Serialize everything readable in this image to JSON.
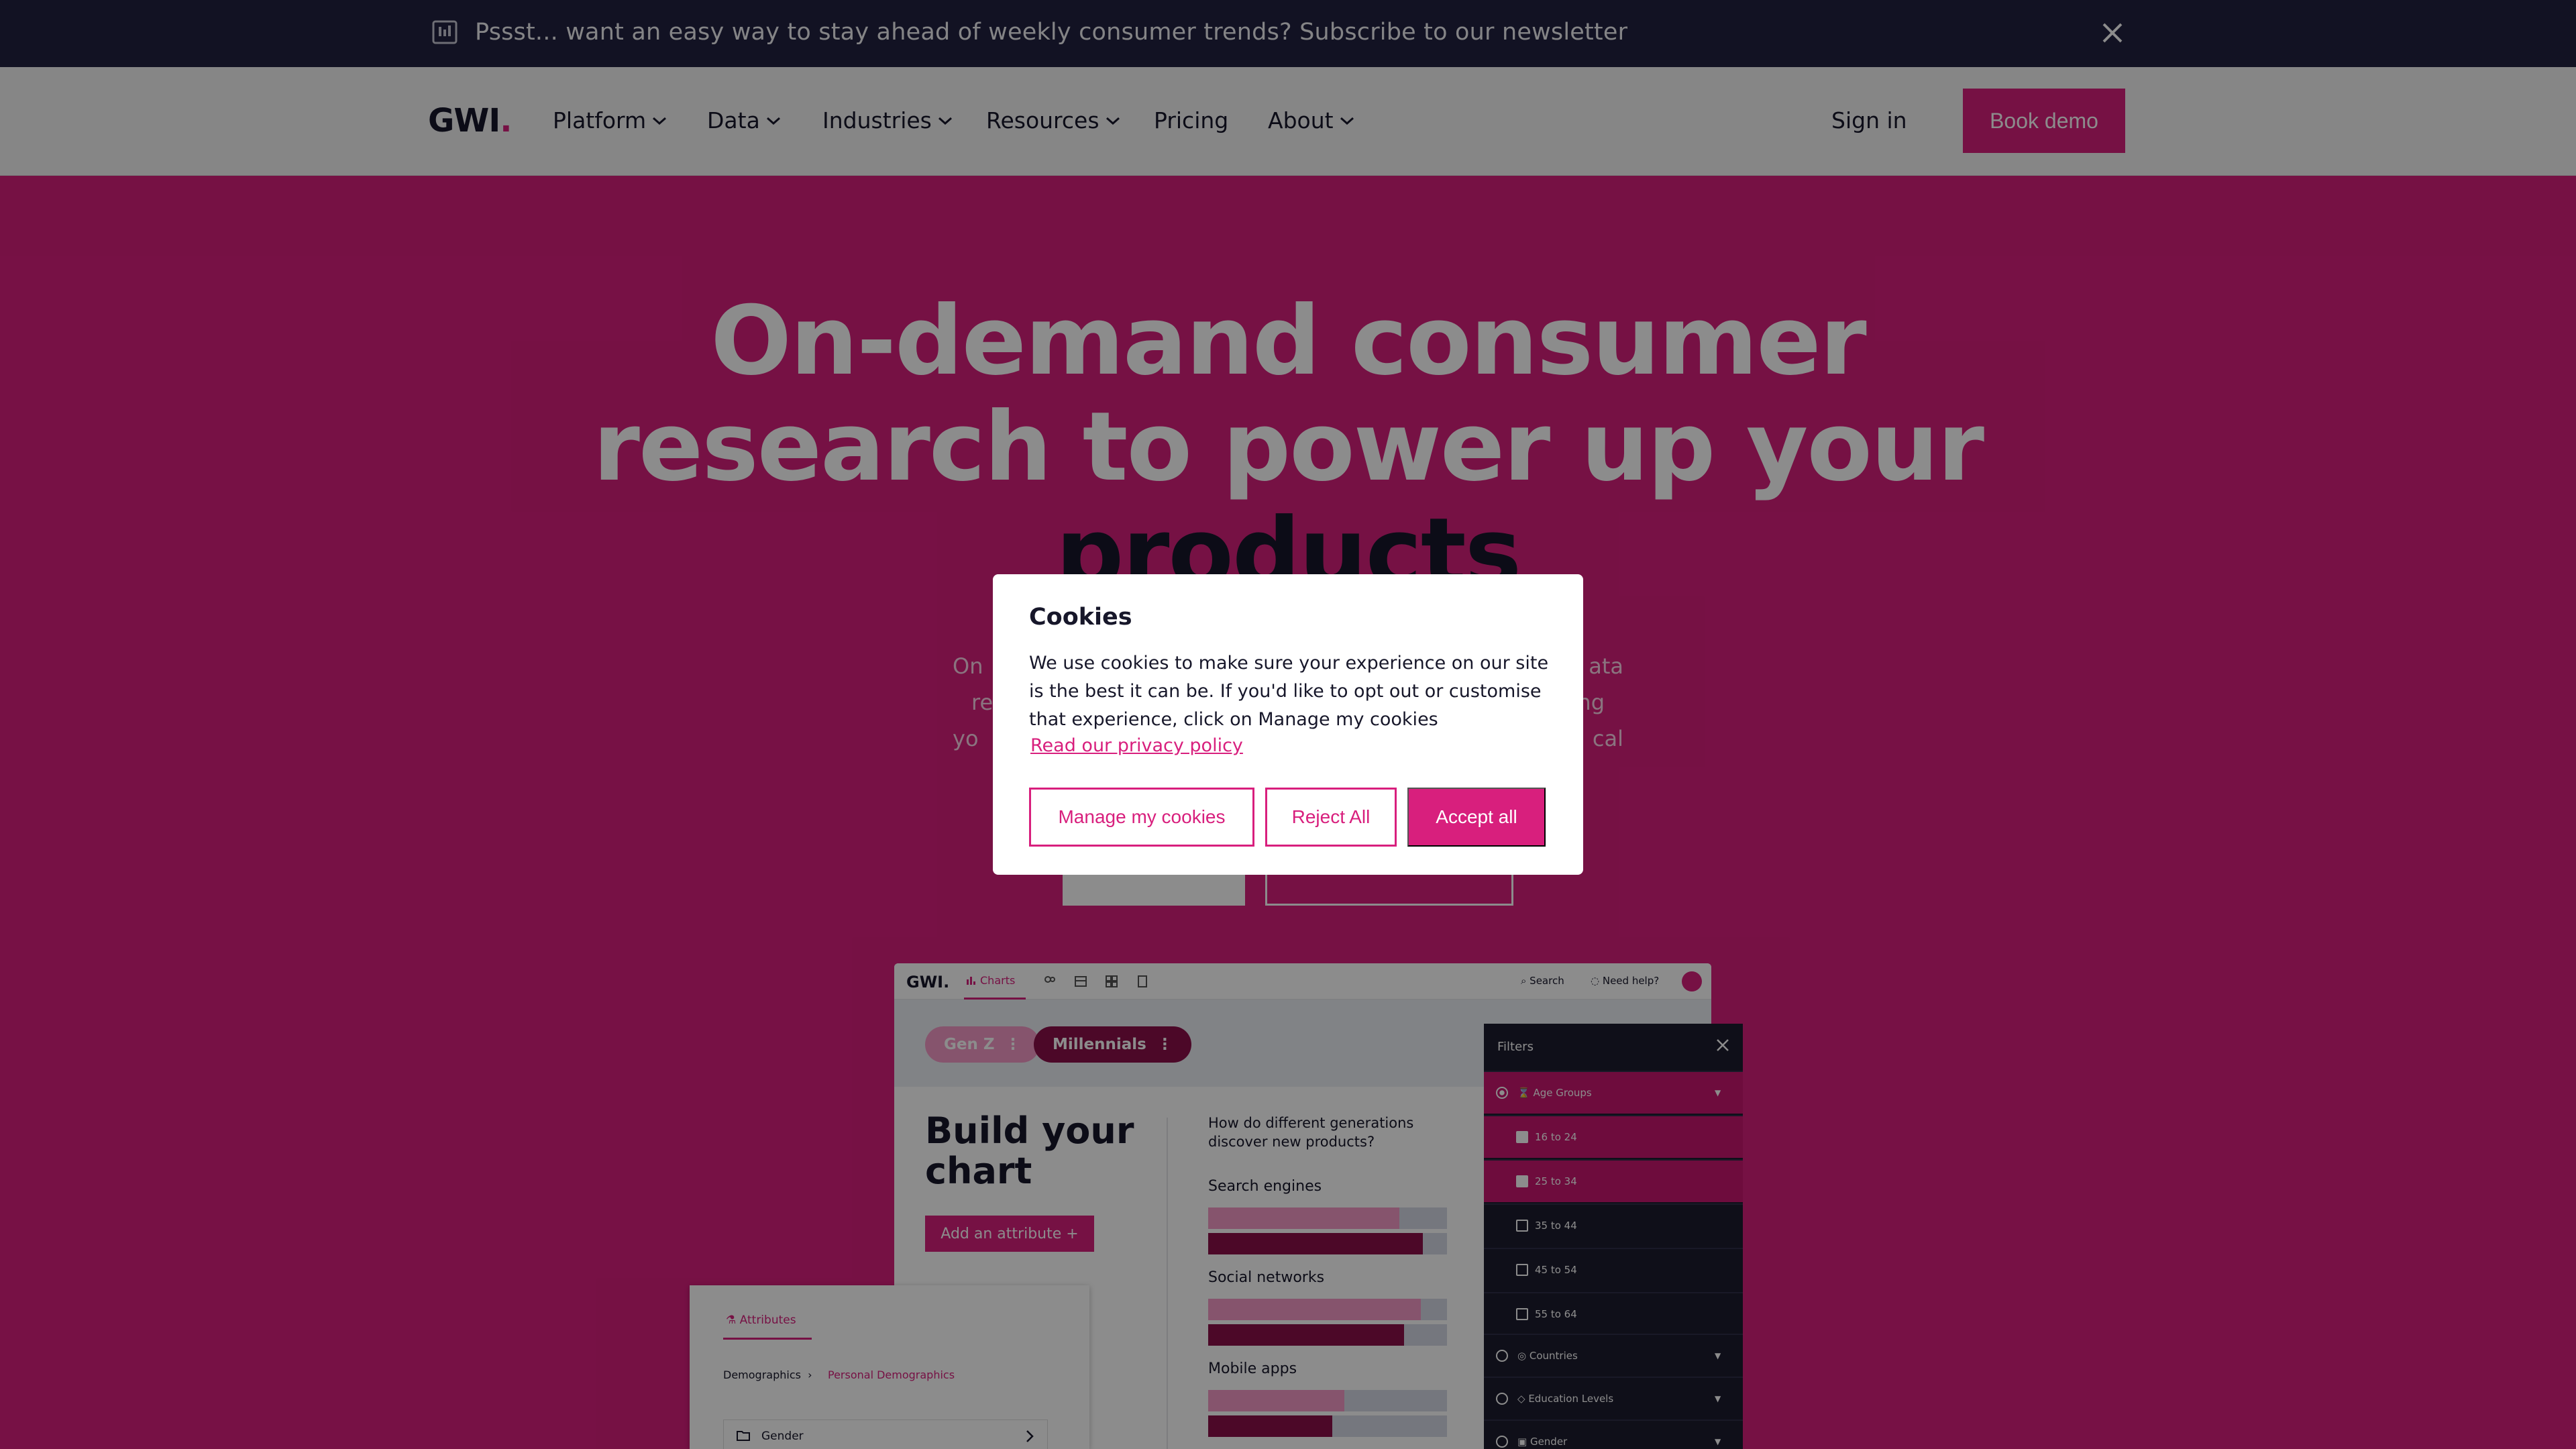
{
  "banner": {
    "text": "Pssst... want an easy way to stay ahead of weekly consumer trends? Subscribe to our newsletter",
    "icon": "newsletter-icon",
    "close_icon": "close-icon"
  },
  "nav": {
    "logo": "GWI",
    "logo_dot": ".",
    "items": [
      {
        "label": "Platform",
        "has_dropdown": true
      },
      {
        "label": "Data",
        "has_dropdown": true
      },
      {
        "label": "Industries",
        "has_dropdown": true
      },
      {
        "label": "Resources",
        "has_dropdown": true
      },
      {
        "label": "Pricing",
        "has_dropdown": false
      },
      {
        "label": "About",
        "has_dropdown": true
      }
    ],
    "sign_in": "Sign in",
    "book_demo": "Book demo"
  },
  "hero": {
    "title_line1": "On-demand consumer",
    "title_line2": "research to power up your",
    "title_line3": "products",
    "sub_line1_left": "On",
    "sub_line1_right": "ata",
    "sub_line2_left": "re",
    "sub_line2_right": "ng",
    "sub_line3_left": "yo",
    "sub_line3_right": "cal"
  },
  "app_mock": {
    "logo": "GWI.",
    "tab_charts": "Charts",
    "search": "Search",
    "help": "Need help?",
    "chips": [
      "Gen Z",
      "Millennials"
    ],
    "build_title_line1": "Build your",
    "build_title_line2": "chart",
    "add_attribute": "Add an attribute +",
    "question": "How do different generations discover new products?",
    "bars": [
      {
        "label": "Search engines",
        "gen_z": 0.8,
        "millennials": 0.9
      },
      {
        "label": "Social networks",
        "gen_z": 0.89,
        "millennials": 0.82
      },
      {
        "label": "Mobile apps",
        "gen_z": 0.57,
        "millennials": 0.52
      }
    ],
    "colors": {
      "gen_z": "#f59ac6",
      "millennials": "#8a1049",
      "accent": "#d81f7d"
    }
  },
  "filters": {
    "title": "Filters",
    "group": "Age Groups",
    "options": [
      {
        "label": "16 to 24",
        "checked": true
      },
      {
        "label": "25 to 34",
        "checked": true
      },
      {
        "label": "35 to 44",
        "checked": false
      },
      {
        "label": "45 to 54",
        "checked": false
      },
      {
        "label": "55 to 64",
        "checked": false
      }
    ],
    "other_groups": [
      "Countries",
      "Education Levels",
      "Gender"
    ]
  },
  "attributes_card": {
    "tab": "Attributes",
    "crumb_root": "Demographics",
    "crumb_child": "Personal Demographics",
    "item": "Gender"
  },
  "cookie_dialog": {
    "title": "Cookies",
    "body": "We use cookies to make sure your experience on our site is the best it can be. If you'd like to opt out or customise that experience, click on Manage my cookies",
    "policy_link": "Read our privacy policy",
    "manage": "Manage my cookies",
    "reject": "Reject All",
    "accept": "Accept all"
  }
}
